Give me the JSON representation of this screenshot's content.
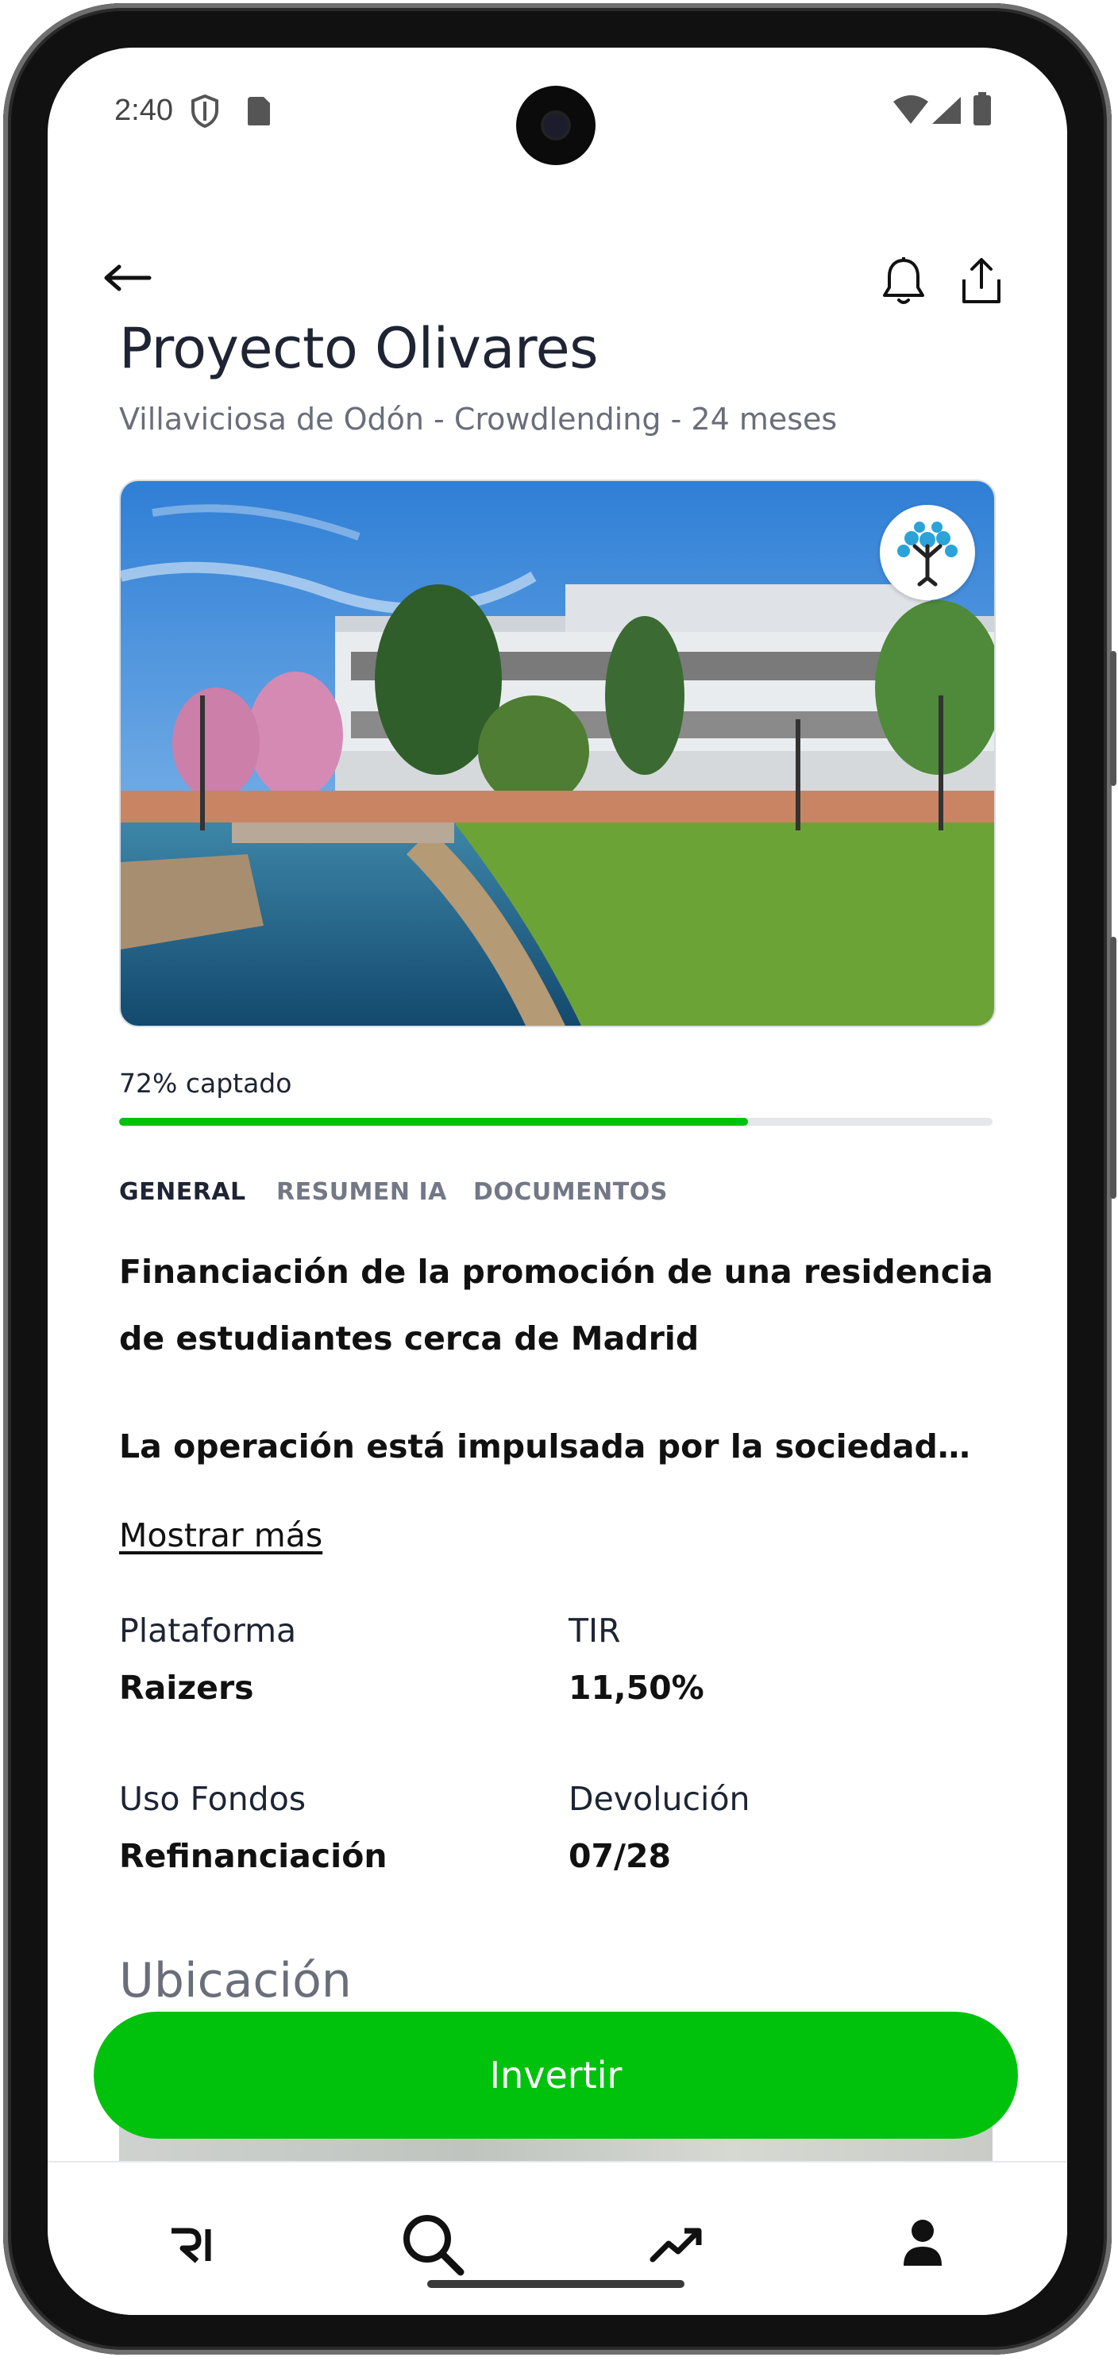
{
  "status_bar": {
    "time": "2:40"
  },
  "header": {
    "back_icon": "arrow-left-icon",
    "actions": [
      "bell-icon",
      "share-icon"
    ]
  },
  "project": {
    "title": "Proyecto Olivares",
    "subtitle": "Villaviciosa de Odón - Crowdlending - 24 meses",
    "image_alt": "residence-photo",
    "badge_icon": "tree-logo-icon"
  },
  "funding": {
    "label": "72% captado",
    "progress": 0.72,
    "color": "#00c20d"
  },
  "tabs": [
    {
      "label": "GENERAL",
      "active": true
    },
    {
      "label": "RESUMEN IA",
      "active": false
    },
    {
      "label": "DOCUMENTOS",
      "active": false
    }
  ],
  "description": {
    "heading": "Financiación de la promoción de una residencia de estudiantes cerca de Madrid",
    "body": "La operación está impulsada por la sociedad…",
    "show_more": "Mostrar más"
  },
  "details": [
    {
      "label": "Plataforma",
      "value": "Raizers"
    },
    {
      "label": "TIR",
      "value": "11,50%"
    },
    {
      "label": "Uso Fondos",
      "value": "Refinanciación"
    },
    {
      "label": "Devolución",
      "value": "07/28"
    }
  ],
  "location": {
    "heading": "Ubicación"
  },
  "cta": {
    "label": "Invertir"
  },
  "bottom_nav": [
    {
      "icon": "ri-logo-icon"
    },
    {
      "icon": "search-icon"
    },
    {
      "icon": "trending-up-icon"
    },
    {
      "icon": "user-icon"
    }
  ],
  "colors": {
    "accent": "#00c20d",
    "text": "#1e2433",
    "muted": "#6a6e7a"
  }
}
